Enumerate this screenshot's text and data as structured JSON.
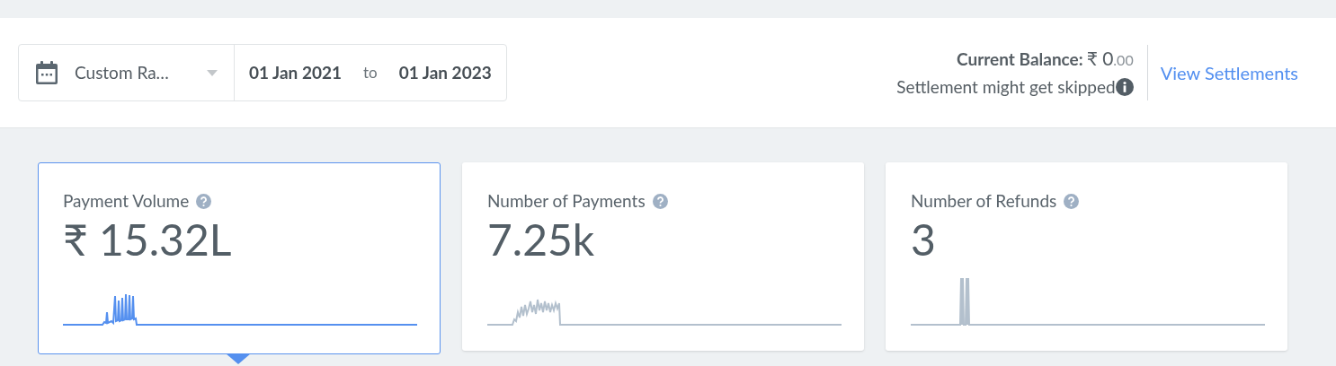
{
  "date_filter": {
    "preset": "Custom Ra…",
    "from": "01 Jan 2021",
    "separator": "to",
    "to": "01 Jan 2023"
  },
  "balance": {
    "label": "Current Balance:",
    "amount": "₹ 0",
    "decimals": ".00",
    "note": "Settlement might get skipped",
    "link": "View Settlements"
  },
  "cards": [
    {
      "title": "Payment Volume",
      "value": "₹ 15.32L",
      "selected": true
    },
    {
      "title": "Number of Payments",
      "value": "7.25k",
      "selected": false
    },
    {
      "title": "Number of Refunds",
      "value": "3",
      "selected": false
    }
  ]
}
